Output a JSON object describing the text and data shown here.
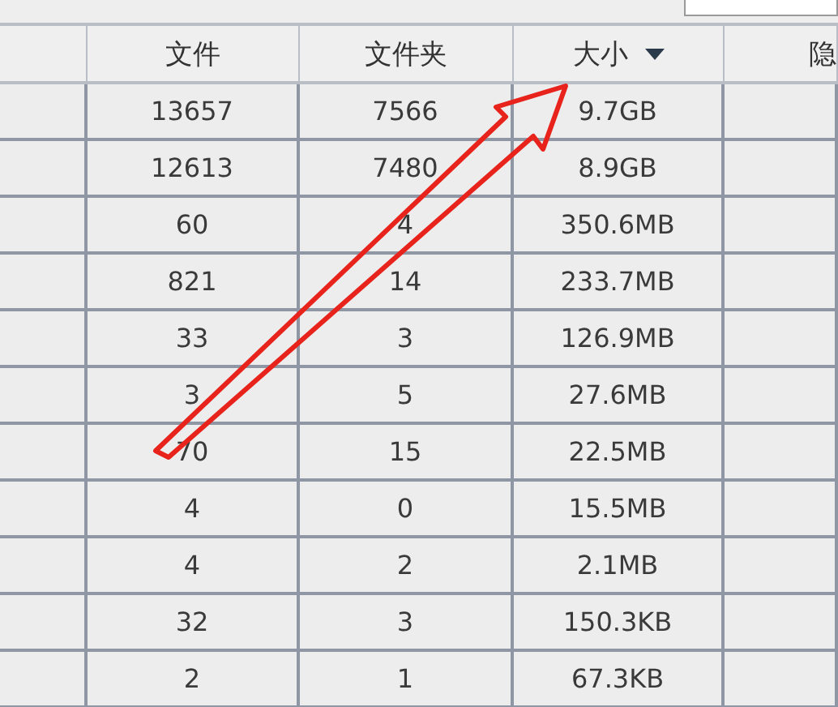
{
  "search_field": {
    "kind": "field"
  },
  "table": {
    "columns": [
      {
        "label": "文件",
        "sorted": false
      },
      {
        "label": "文件夹",
        "sorted": false
      },
      {
        "label": "大小",
        "sorted": true
      },
      {
        "label": "隐",
        "sorted": false
      }
    ],
    "rows": [
      {
        "cells": [
          "13657",
          "7566",
          "9.7GB"
        ]
      },
      {
        "cells": [
          "12613",
          "7480",
          "8.9GB"
        ]
      },
      {
        "cells": [
          "60",
          "4",
          "350.6MB"
        ]
      },
      {
        "cells": [
          "821",
          "14",
          "233.7MB"
        ]
      },
      {
        "cells": [
          "33",
          "3",
          "126.9MB"
        ]
      },
      {
        "cells": [
          "3",
          "5",
          "27.6MB"
        ]
      },
      {
        "cells": [
          "70",
          "15",
          "22.5MB"
        ]
      },
      {
        "cells": [
          "4",
          "0",
          "15.5MB"
        ]
      },
      {
        "cells": [
          "4",
          "2",
          "2.1MB"
        ]
      },
      {
        "cells": [
          "32",
          "3",
          "150.3KB"
        ]
      },
      {
        "cells": [
          "2",
          "1",
          "67.3KB"
        ]
      }
    ]
  },
  "annotation": {
    "kind": "arrow"
  }
}
